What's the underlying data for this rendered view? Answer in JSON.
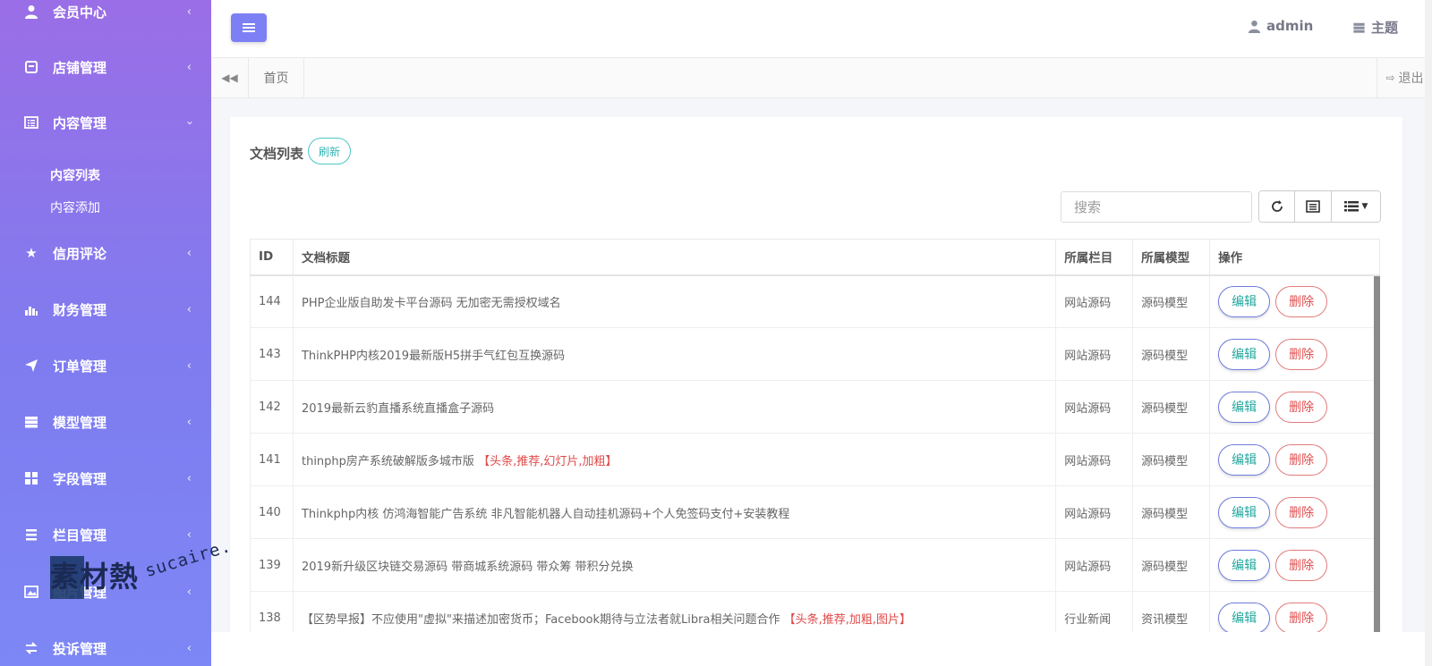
{
  "sidebar": {
    "items": [
      {
        "label": "会员中心",
        "icon": "user-icon",
        "caret": "‹"
      },
      {
        "label": "店铺管理",
        "icon": "store-icon",
        "caret": "‹"
      },
      {
        "label": "内容管理",
        "icon": "list-alt-icon",
        "caret": "›"
      },
      {
        "label": "信用评论",
        "icon": "star-icon",
        "caret": "‹"
      },
      {
        "label": "财务管理",
        "icon": "bar-chart-icon",
        "caret": "‹"
      },
      {
        "label": "订单管理",
        "icon": "send-icon",
        "caret": "‹"
      },
      {
        "label": "模型管理",
        "icon": "server-icon",
        "caret": "‹"
      },
      {
        "label": "字段管理",
        "icon": "grid-icon",
        "caret": "‹"
      },
      {
        "label": "栏目管理",
        "icon": "bars-icon",
        "caret": "‹"
      },
      {
        "label": "图片管理",
        "icon": "image-icon",
        "caret": "‹"
      },
      {
        "label": "投诉管理",
        "icon": "exchange-icon",
        "caret": "‹"
      }
    ],
    "subitems": [
      {
        "label": "内容列表",
        "active": true
      },
      {
        "label": "内容添加",
        "active": false
      }
    ]
  },
  "watermark": {
    "brand": "素材熱",
    "url": "sucaire.com"
  },
  "header": {
    "user": "admin",
    "theme": "主题"
  },
  "tabs": {
    "home": "首页",
    "logout": "退出"
  },
  "panel": {
    "title": "文档列表",
    "refresh": "刷新",
    "search_placeholder": "搜索"
  },
  "table": {
    "columns": [
      "ID",
      "文档标题",
      "所属栏目",
      "所属模型",
      "操作"
    ],
    "edit_label": "编辑",
    "delete_label": "删除",
    "rows": [
      {
        "id": "144",
        "title": "PHP企业版自助发卡平台源码 无加密无需授权域名",
        "tag": "",
        "category": "网站源码",
        "model": "源码模型"
      },
      {
        "id": "143",
        "title": "ThinkPHP内核2019最新版H5拼手气红包互换源码",
        "tag": "",
        "category": "网站源码",
        "model": "源码模型"
      },
      {
        "id": "142",
        "title": "2019最新云豹直播系统直播盒子源码",
        "tag": "",
        "category": "网站源码",
        "model": "源码模型"
      },
      {
        "id": "141",
        "title": "thinphp房产系统破解版多城市版",
        "tag": "【头条,推荐,幻灯片,加粗】",
        "category": "网站源码",
        "model": "源码模型"
      },
      {
        "id": "140",
        "title": "Thinkphp内核 仿鸿海智能广告系统 非凡智能机器人自动挂机源码+个人免签码支付+安装教程",
        "tag": "",
        "category": "网站源码",
        "model": "源码模型"
      },
      {
        "id": "139",
        "title": "2019新升级区块链交易源码 带商城系统源码 带众筹 带积分兑换",
        "tag": "",
        "category": "网站源码",
        "model": "源码模型"
      },
      {
        "id": "138",
        "title": "【区势早报】不应使用\"虚拟\"来描述加密货币；Facebook期待与立法者就Libra相关问题合作",
        "tag": "【头条,推荐,加粗,图片】",
        "category": "行业新闻",
        "model": "资讯模型"
      }
    ]
  },
  "colors": {
    "accent": "#7d7ff5",
    "sidebar_top": "#9a6ee6",
    "sidebar_bottom": "#7d87f5",
    "tag_red": "#e04a4a",
    "teal": "#35b4b4"
  }
}
